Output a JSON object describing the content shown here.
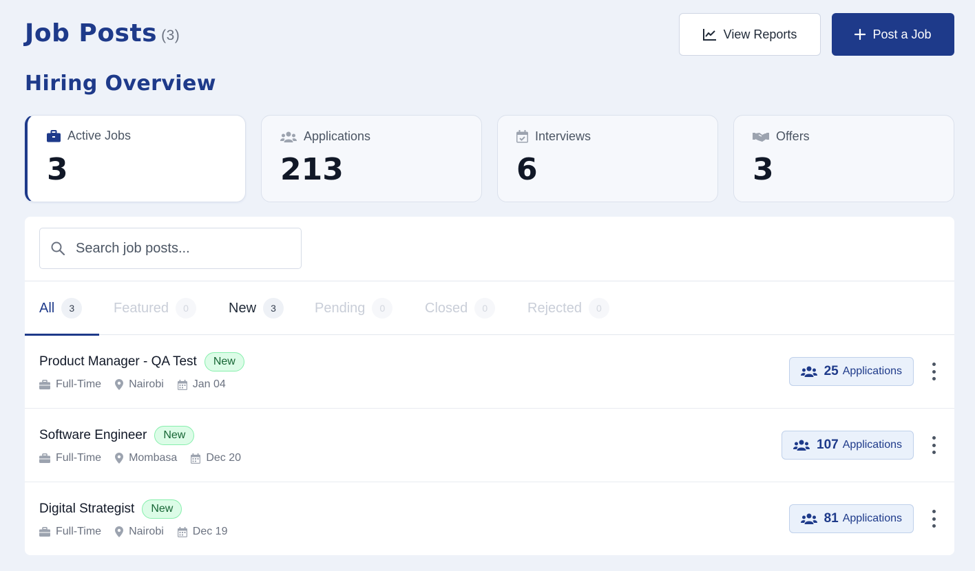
{
  "header": {
    "title": "Job Posts",
    "count": "(3)",
    "view_reports_label": "View Reports",
    "post_job_label": "Post a Job"
  },
  "overview": {
    "title": "Hiring Overview",
    "stats": [
      {
        "label": "Active Jobs",
        "value": "3",
        "icon": "briefcase-icon"
      },
      {
        "label": "Applications",
        "value": "213",
        "icon": "users-icon"
      },
      {
        "label": "Interviews",
        "value": "6",
        "icon": "calendar-check-icon"
      },
      {
        "label": "Offers",
        "value": "3",
        "icon": "handshake-icon"
      }
    ]
  },
  "search": {
    "placeholder": "Search job posts..."
  },
  "tabs": [
    {
      "label": "All",
      "count": "3"
    },
    {
      "label": "Featured",
      "count": "0"
    },
    {
      "label": "New",
      "count": "3"
    },
    {
      "label": "Pending",
      "count": "0"
    },
    {
      "label": "Closed",
      "count": "0"
    },
    {
      "label": "Rejected",
      "count": "0"
    }
  ],
  "jobs": [
    {
      "title": "Product Manager - QA Test",
      "badge": "New",
      "type": "Full-Time",
      "location": "Nairobi",
      "date": "Jan 04",
      "applications": "25",
      "applications_label": "Applications"
    },
    {
      "title": "Software Engineer",
      "badge": "New",
      "type": "Full-Time",
      "location": "Mombasa",
      "date": "Dec 20",
      "applications": "107",
      "applications_label": "Applications"
    },
    {
      "title": "Digital Strategist",
      "badge": "New",
      "type": "Full-Time",
      "location": "Nairobi",
      "date": "Dec 19",
      "applications": "81",
      "applications_label": "Applications"
    }
  ],
  "colors": {
    "accent": "#1e3a8a",
    "badge_bg": "#dcfce7",
    "badge_text": "#166534",
    "background": "#eef2f9"
  }
}
